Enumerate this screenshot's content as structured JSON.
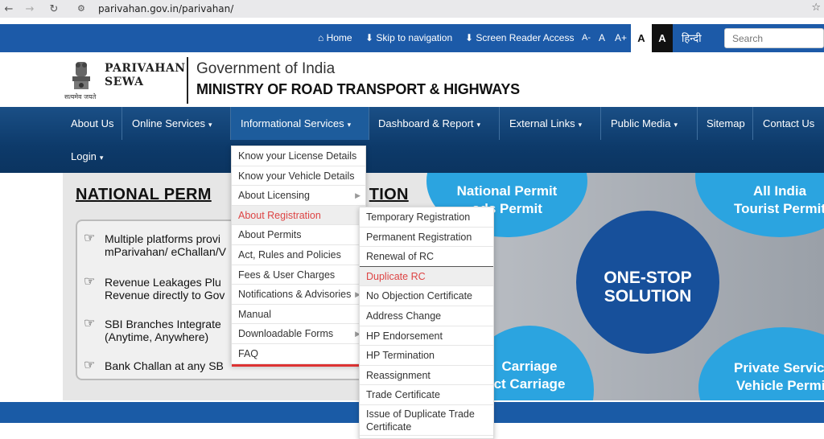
{
  "browser": {
    "url": "parivahan.gov.in/parivahan/"
  },
  "utility": {
    "home": "Home",
    "skip": "Skip to navigation",
    "screen_reader": "Screen Reader Access",
    "font_decrease": "A-",
    "font_normal": "A",
    "font_increase": "A+",
    "theme_light": "A",
    "theme_dark": "A",
    "hindi": "हिन्दी",
    "search_placeholder": "Search"
  },
  "header": {
    "emblem_caption": "सत्यमेव जयते",
    "brand_line1": "PARIVAHAN",
    "brand_line2": "SEWA",
    "gov": "Government of India",
    "ministry": "MINISTRY OF ROAD TRANSPORT & HIGHWAYS"
  },
  "nav": {
    "items": [
      {
        "label": "About Us"
      },
      {
        "label": "Online Services"
      },
      {
        "label": "Informational Services"
      },
      {
        "label": "Dashboard & Report"
      },
      {
        "label": "External Links"
      },
      {
        "label": "Public Media"
      },
      {
        "label": "Sitemap"
      },
      {
        "label": "Contact Us"
      },
      {
        "label": "Login"
      }
    ]
  },
  "banner": {
    "title": "NATIONAL PERM",
    "title_end": "TION",
    "bullets": [
      {
        "line1": "Multiple platforms provi",
        "line2": "mParivahan/ eChallan/V"
      },
      {
        "line1": "Revenue Leakages Plu",
        "line2": "Revenue directly to Gov"
      },
      {
        "line1": "SBI Branches Integrate",
        "line2": "(Anytime, Anywhere)"
      },
      {
        "line1": "Bank Challan at any SB",
        "line2": ""
      }
    ],
    "circle_national": {
      "line1": "National Permit",
      "line2": "ods Permit"
    },
    "circle_tourist": {
      "line1": "All India",
      "line2": "Tourist Permit"
    },
    "circle_center": {
      "line1": "ONE-STOP",
      "line2": "SOLUTION"
    },
    "circle_carriage": {
      "line1": "Carriage",
      "line2": "ct Carriage"
    },
    "circle_private": {
      "line1": "Private Service",
      "line2": "Vehicle Permit"
    }
  },
  "info_menu": {
    "items": [
      {
        "label": "Know your License Details"
      },
      {
        "label": "Know your Vehicle Details"
      },
      {
        "label": "About Licensing"
      },
      {
        "label": "About Registration"
      },
      {
        "label": "About Permits"
      },
      {
        "label": "Act, Rules and Policies"
      },
      {
        "label": "Fees & User Charges"
      },
      {
        "label": "Notifications & Advisories"
      },
      {
        "label": "Manual"
      },
      {
        "label": "Downloadable Forms"
      },
      {
        "label": "FAQ"
      }
    ]
  },
  "registration_menu": {
    "items": [
      {
        "label": "Temporary Registration"
      },
      {
        "label": "Permanent Registration"
      },
      {
        "label": "Renewal of RC"
      },
      {
        "label": "Duplicate RC"
      },
      {
        "label": "No Objection Certificate"
      },
      {
        "label": "Address Change"
      },
      {
        "label": "HP Endorsement"
      },
      {
        "label": "HP Termination"
      },
      {
        "label": "Reassignment"
      },
      {
        "label": "Trade Certificate"
      },
      {
        "label": "Issue of Duplicate Trade Certificate"
      }
    ]
  },
  "colors": {
    "utility_bar": "#1c5aa8",
    "nav_bar": "#0d3a6a",
    "highlight": "#dd4444"
  }
}
